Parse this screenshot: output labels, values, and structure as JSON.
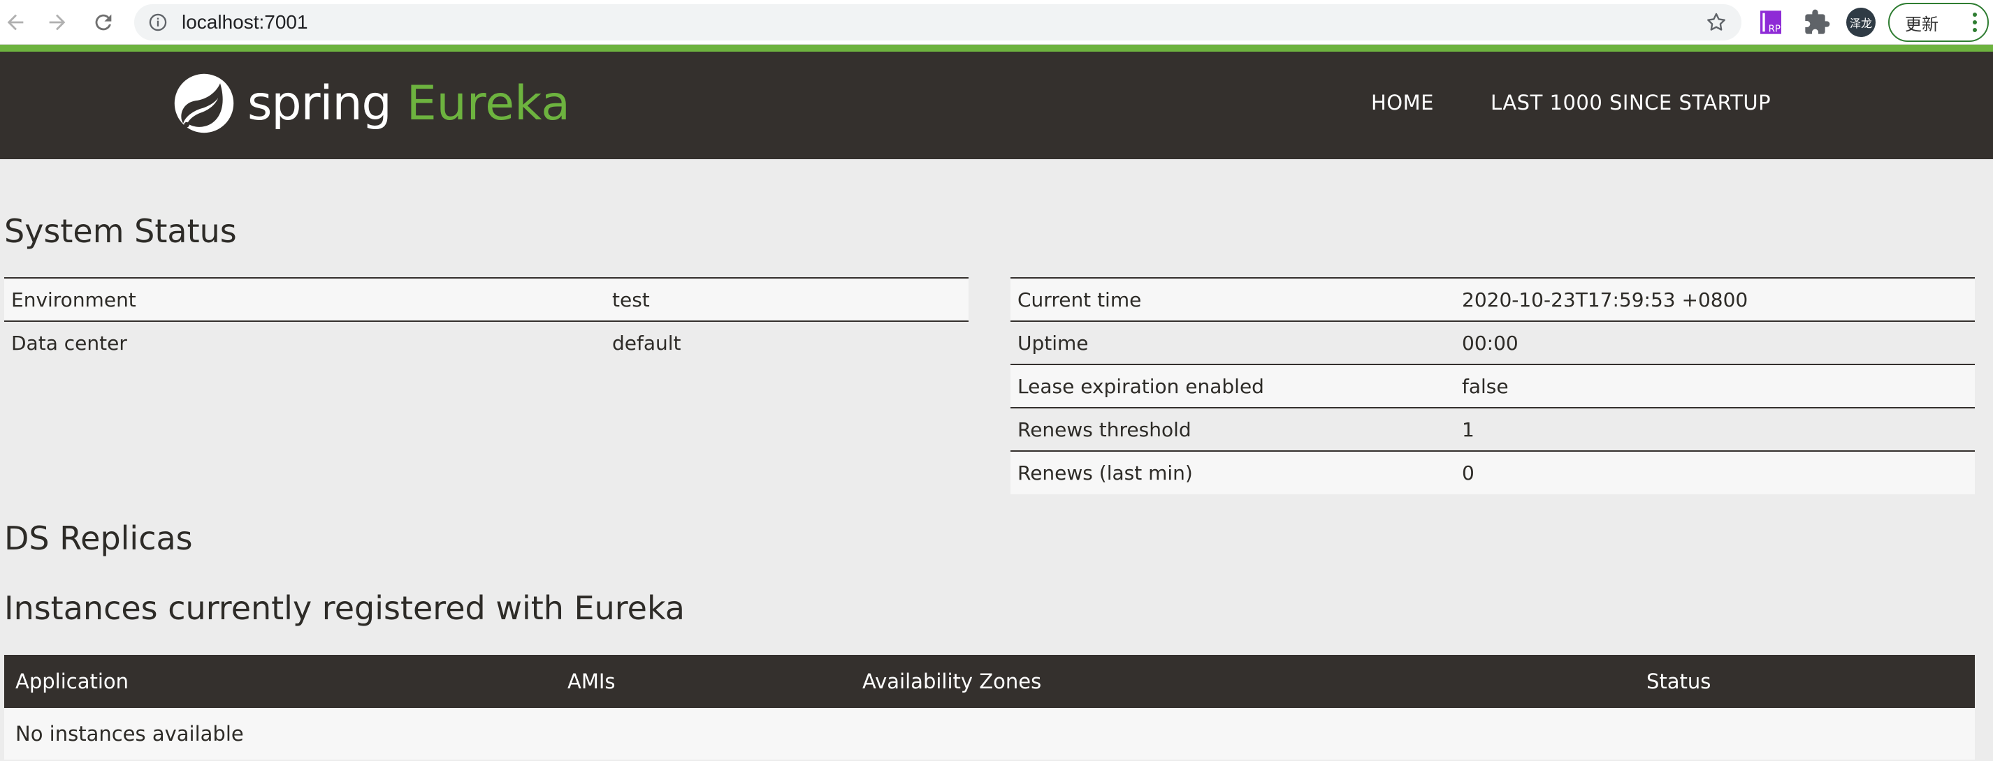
{
  "browser": {
    "url": "localhost:7001",
    "avatar_text": "泽龙",
    "update_label": "更新",
    "ext_badge_text": "RP"
  },
  "header": {
    "logo_spring": "spring",
    "logo_eureka": "Eureka",
    "nav": {
      "home": "HOME",
      "last": "LAST 1000 SINCE STARTUP"
    }
  },
  "system_status": {
    "title": "System Status",
    "left": [
      {
        "label": "Environment",
        "value": "test"
      },
      {
        "label": "Data center",
        "value": "default"
      }
    ],
    "right": [
      {
        "label": "Current time",
        "value": "2020-10-23T17:59:53 +0800"
      },
      {
        "label": "Uptime",
        "value": "00:00"
      },
      {
        "label": "Lease expiration enabled",
        "value": "false"
      },
      {
        "label": "Renews threshold",
        "value": "1"
      },
      {
        "label": "Renews (last min)",
        "value": "0"
      }
    ]
  },
  "replicas": {
    "title": "DS Replicas"
  },
  "instances": {
    "title": "Instances currently registered with Eureka",
    "columns": [
      "Application",
      "AMIs",
      "Availability Zones",
      "Status"
    ],
    "empty_text": "No instances available"
  },
  "colors": {
    "spring_green": "#6db33f",
    "header_dark": "#34302d",
    "page_bg": "#ececec"
  }
}
